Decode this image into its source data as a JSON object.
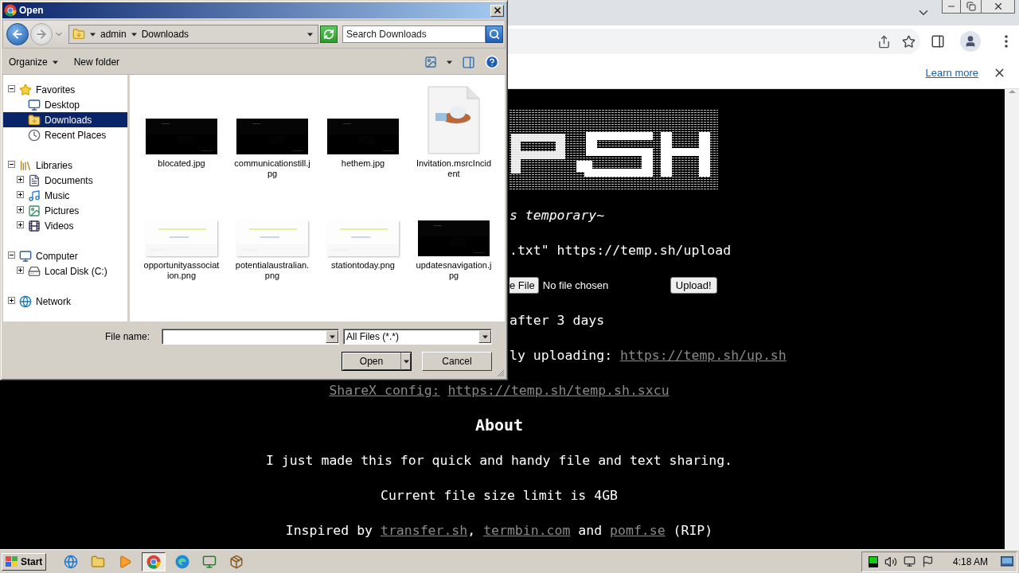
{
  "dialog": {
    "title": "Open",
    "breadcrumb": [
      "admin",
      "Downloads"
    ],
    "search": {
      "placeholder": "Search Downloads"
    },
    "toolbar": [
      {
        "label": "Organize",
        "kind": "menu"
      },
      {
        "label": "New folder",
        "kind": "button"
      }
    ],
    "nav": [
      {
        "label": "Favorites",
        "kind": "star",
        "expanded": true,
        "selected": false,
        "children": [
          {
            "label": "Desktop",
            "kind": "desktop",
            "selected": false
          },
          {
            "label": "Downloads",
            "kind": "downloads",
            "selected": true
          },
          {
            "label": "Recent Places",
            "kind": "recent",
            "selected": false
          }
        ]
      },
      {
        "label": "Libraries",
        "kind": "libraries",
        "expanded": true,
        "selected": false,
        "children": [
          {
            "label": "Documents",
            "kind": "documents",
            "expanded": false,
            "selected": false
          },
          {
            "label": "Music",
            "kind": "music",
            "expanded": false,
            "selected": false
          },
          {
            "label": "Pictures",
            "kind": "pictures",
            "expanded": false,
            "selected": false
          },
          {
            "label": "Videos",
            "kind": "videos",
            "expanded": false,
            "selected": false
          }
        ]
      },
      {
        "label": "Computer",
        "kind": "computer",
        "expanded": true,
        "selected": false,
        "children": [
          {
            "label": "Local Disk (C:)",
            "kind": "disk",
            "expanded": false,
            "selected": false
          }
        ]
      },
      {
        "label": "Network",
        "kind": "network",
        "expanded": false,
        "selected": false
      }
    ],
    "files": [
      {
        "name": "blocated.jpg",
        "kind": "dark"
      },
      {
        "name": "communicationstill.jpg",
        "kind": "dark"
      },
      {
        "name": "hethem.jpg",
        "kind": "dark"
      },
      {
        "name": "Invitation.msrcIncident",
        "kind": "document"
      },
      {
        "name": "opportunityassociation.png",
        "kind": "light"
      },
      {
        "name": "potentialaustralian.png",
        "kind": "light"
      },
      {
        "name": "stationtoday.png",
        "kind": "light"
      },
      {
        "name": "updatesnavigation.jpg",
        "kind": "dark"
      }
    ],
    "file_name_label": "File name:",
    "file_type": "All Files (*.*)",
    "buttons": [
      {
        "label": "Open",
        "kind": "split"
      },
      {
        "label": "Cancel",
        "kind": "plain"
      }
    ]
  },
  "browser": {
    "infobar": {
      "link": "Learn more"
    },
    "lines": [
      {
        "kind": "logo"
      },
      {
        "kind": "cut",
        "italic": true,
        "parts": [
          {
            "text": "s temporary~",
            "kind": "text"
          }
        ]
      },
      {
        "kind": "cut",
        "parts": [
          {
            "text": ".txt\" https://temp.sh/upload",
            "kind": "text"
          }
        ]
      },
      {
        "kind": "form",
        "choose_button": "e File",
        "status": "No file chosen",
        "upload_button": "Upload!"
      },
      {
        "kind": "cut",
        "parts": [
          {
            "text": "after 3 days",
            "kind": "text"
          }
        ]
      },
      {
        "kind": "cut",
        "parts": [
          {
            "text": "ly uploading: ",
            "kind": "text"
          },
          {
            "text": "https://temp.sh/up.sh",
            "kind": "link"
          }
        ]
      },
      {
        "kind": "center",
        "parts": [
          {
            "text": "ShareX config:",
            "kind": "link"
          },
          {
            "text": "https://temp.sh/temp.sh.sxcu",
            "kind": "link"
          }
        ]
      },
      {
        "kind": "heading",
        "parts": [
          {
            "text": "About",
            "kind": "text"
          }
        ]
      },
      {
        "kind": "center",
        "parts": [
          {
            "text": "I just made this for quick and handy file and text sharing.",
            "kind": "text"
          }
        ]
      },
      {
        "kind": "center",
        "parts": [
          {
            "text": "Current file size limit is 4GB",
            "kind": "text"
          }
        ]
      },
      {
        "kind": "center",
        "parts": [
          {
            "text": "Inspired by ",
            "kind": "text"
          },
          {
            "text": "transfer.sh",
            "kind": "link"
          },
          {
            "text": ", ",
            "kind": "text"
          },
          {
            "text": "termbin.com",
            "kind": "link"
          },
          {
            "text": " and ",
            "kind": "text"
          },
          {
            "text": "pomf.se",
            "kind": "link"
          },
          {
            "text": " (RIP)",
            "kind": "text"
          }
        ]
      }
    ]
  },
  "taskbar": {
    "start": "Start",
    "apps": [
      {
        "kind": "ie",
        "selected": false
      },
      {
        "kind": "folder",
        "selected": false
      },
      {
        "kind": "media",
        "selected": false
      },
      {
        "kind": "chrome",
        "selected": true
      },
      {
        "kind": "edge",
        "selected": false
      },
      {
        "kind": "monitor",
        "selected": false
      },
      {
        "kind": "installer",
        "selected": false
      }
    ],
    "clock": "4:18 AM"
  }
}
